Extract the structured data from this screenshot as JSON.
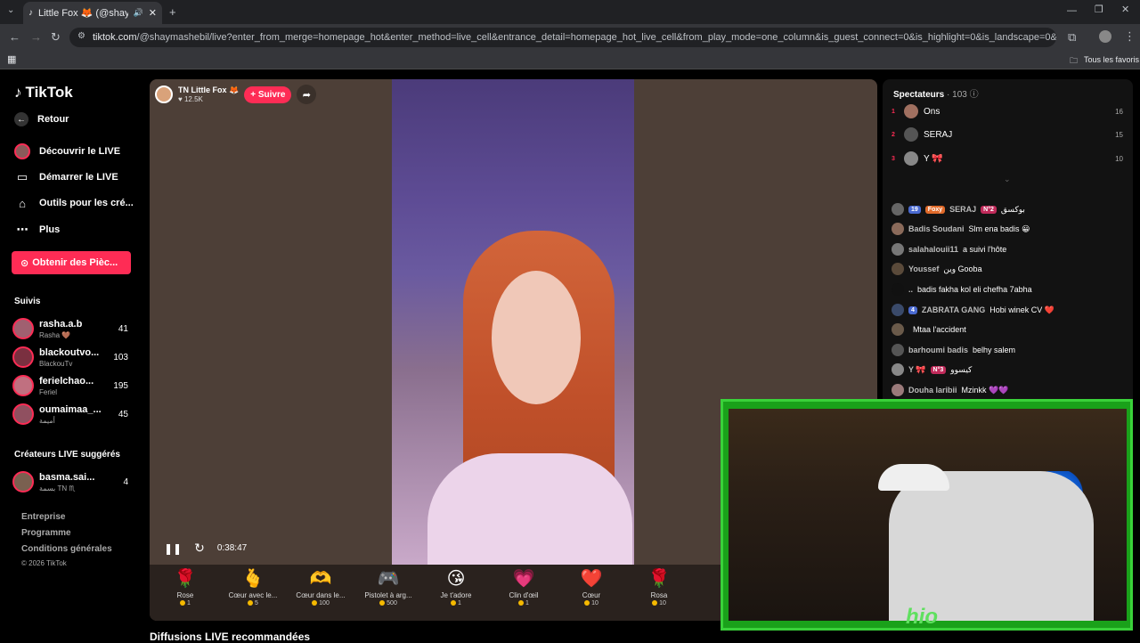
{
  "browser": {
    "tab_title": "Little Fox 🦊 (@shayma",
    "url_host": "tiktok.com",
    "url_path": "/@shaymashebil/live?enter_from_merge=homepage_hot&enter_method=live_cell&entrance_detail=homepage_hot_live_cell&from_play_mode=one_column&is_guest_connect=0&is_highlight=0&is_landscape=0&request_id=202603310810495...",
    "bookmarks_label": "Tous les favoris"
  },
  "sidebar": {
    "logo": "TikTok",
    "back": "Retour",
    "nav": [
      {
        "label": "Découvrir le LIVE"
      },
      {
        "label": "Démarrer le LIVE"
      },
      {
        "label": "Outils pour les cré..."
      },
      {
        "label": "Plus"
      }
    ],
    "coins_button": "Obtenir des Pièc...",
    "following_title": "Suivis",
    "following": [
      {
        "name": "rasha.a.b",
        "sub": "Rasha 🤎",
        "count": "41"
      },
      {
        "name": "blackoutvo...",
        "sub": "BlackouTv",
        "count": "103"
      },
      {
        "name": "ferielchao...",
        "sub": "Feriel",
        "count": "195"
      },
      {
        "name": "oumaimaa_...",
        "sub": "أميمة",
        "count": "45"
      }
    ],
    "suggested_title": "Créateurs LIVE suggérés",
    "suggested": [
      {
        "name": "basma.sai...",
        "sub": "بسمة TN ♏",
        "count": "4"
      }
    ],
    "footer": [
      "Entreprise",
      "Programme",
      "Conditions générales",
      "© 2026 TikTok"
    ]
  },
  "player": {
    "host_name": "TN Little Fox 🦊",
    "host_likes": "12.5K",
    "follow_label": "+ Suivre",
    "elapsed": "0:38:47",
    "gifts": [
      {
        "icon": "🌹",
        "name": "Rose",
        "price": "1"
      },
      {
        "icon": "🫰",
        "name": "Cœur avec le...",
        "price": "5"
      },
      {
        "icon": "🫶",
        "name": "Cœur dans le...",
        "price": "100"
      },
      {
        "icon": "🎮",
        "name": "Pistolet à arg...",
        "price": "500"
      },
      {
        "icon": "😘",
        "name": "Je t'adore",
        "price": "1"
      },
      {
        "icon": "💗",
        "name": "Clin d'œil",
        "price": "1"
      },
      {
        "icon": "❤️",
        "name": "Cœur",
        "price": "10"
      },
      {
        "icon": "🌹",
        "name": "Rosa",
        "price": "10"
      }
    ]
  },
  "chat": {
    "viewers_label": "Spectateurs",
    "viewers_count": "· 103",
    "top_viewers": [
      {
        "rank": "1",
        "name": "Ons",
        "score": "16"
      },
      {
        "rank": "2",
        "name": "SERAJ",
        "score": "15"
      },
      {
        "rank": "3",
        "name": "Y 🎀",
        "score": "10"
      }
    ],
    "messages": [
      {
        "badges": [
          "19",
          "Foxy",
          "N°2"
        ],
        "user": "SERAJ",
        "text": "بوكسق"
      },
      {
        "badges": [],
        "user": "Badis Soudani",
        "text": "Slm ena badis 😀"
      },
      {
        "badges": [],
        "user": "salahalouii11",
        "text": "a suivi l'hôte"
      },
      {
        "badges": [],
        "user": "Youssef",
        "text": "وين Gooba"
      },
      {
        "badges": [],
        "user": "..",
        "text": "badis fakha kol eli chefha 7abha"
      },
      {
        "badges": [
          "4"
        ],
        "user": "ZABRATA GANG",
        "text": "Hobi winek CV ❤️"
      },
      {
        "badges": [],
        "user": "",
        "text": "Mtaa l'accident"
      },
      {
        "badges": [],
        "user": "barhoumi badis",
        "text": "belhy salem"
      },
      {
        "badges": [
          "N°3"
        ],
        "user": "Y 🎀",
        "text": "كيسوو"
      },
      {
        "badges": [],
        "user": "Douha laribii",
        "text": "Mzinkk 💜💜"
      }
    ]
  },
  "overlay": {
    "logo_text": "hio"
  },
  "recommended_title": "Diffusions LIVE recommandées",
  "colors": {
    "accent": "#fe2c55",
    "overlay_border": "#3ad13a"
  }
}
